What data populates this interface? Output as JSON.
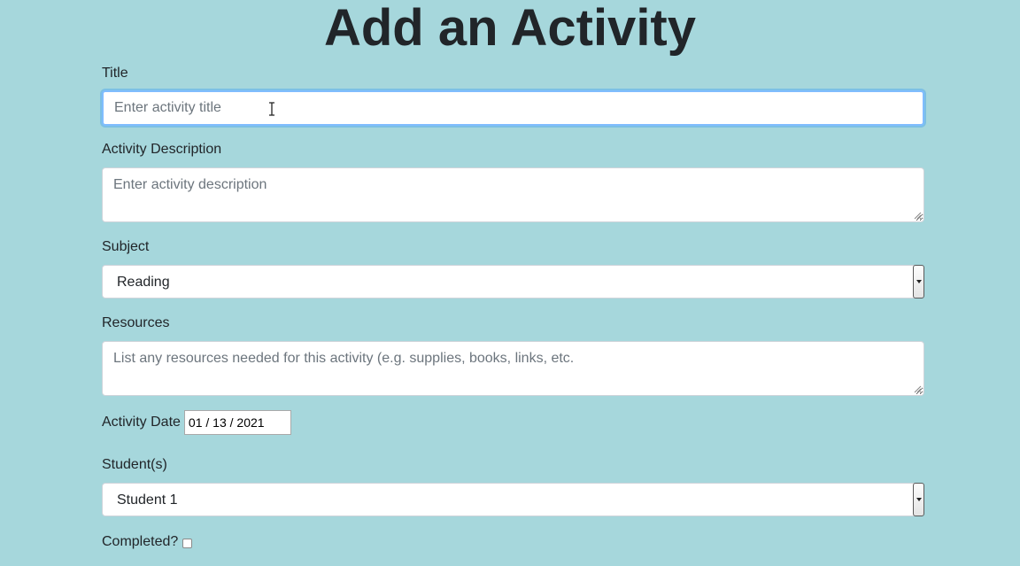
{
  "page": {
    "heading": "Add an Activity"
  },
  "form": {
    "title_label": "Title",
    "title_placeholder": "Enter activity title",
    "description_label": "Activity Description",
    "description_placeholder": "Enter activity description",
    "subject_label": "Subject",
    "subject_selected": "Reading",
    "resources_label": "Resources",
    "resources_placeholder": "List any resources needed for this activity (e.g. supplies, books, links, etc.",
    "date_label": "Activity Date",
    "date_value": "01 / 13 / 2021",
    "students_label": "Student(s)",
    "students_selected": "Student 1",
    "completed_label": "Completed?",
    "completed_checked": false
  },
  "icons": {
    "select_arrow": "chevron-down-icon",
    "cursor": "text-cursor-icon",
    "resize": "resize-grip-icon"
  },
  "colors": {
    "background": "#a6d7dc",
    "focus_border": "#80bdff",
    "text": "#212529",
    "placeholder": "#6c757d"
  }
}
